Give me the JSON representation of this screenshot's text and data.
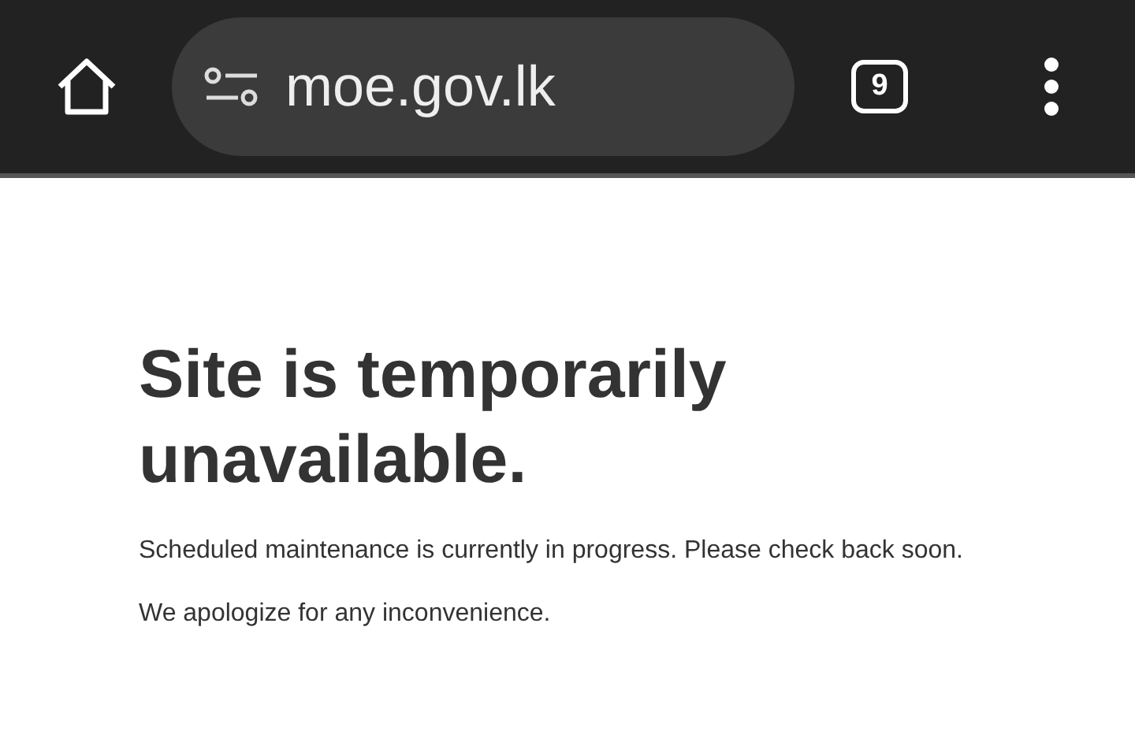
{
  "toolbar": {
    "url": "moe.gov.lk",
    "tab_count": "9"
  },
  "page": {
    "heading": "Site is temporarily unavailable.",
    "paragraphs": [
      "Scheduled maintenance is currently in progress. Please check back soon.",
      "We apologize for any inconvenience."
    ]
  }
}
